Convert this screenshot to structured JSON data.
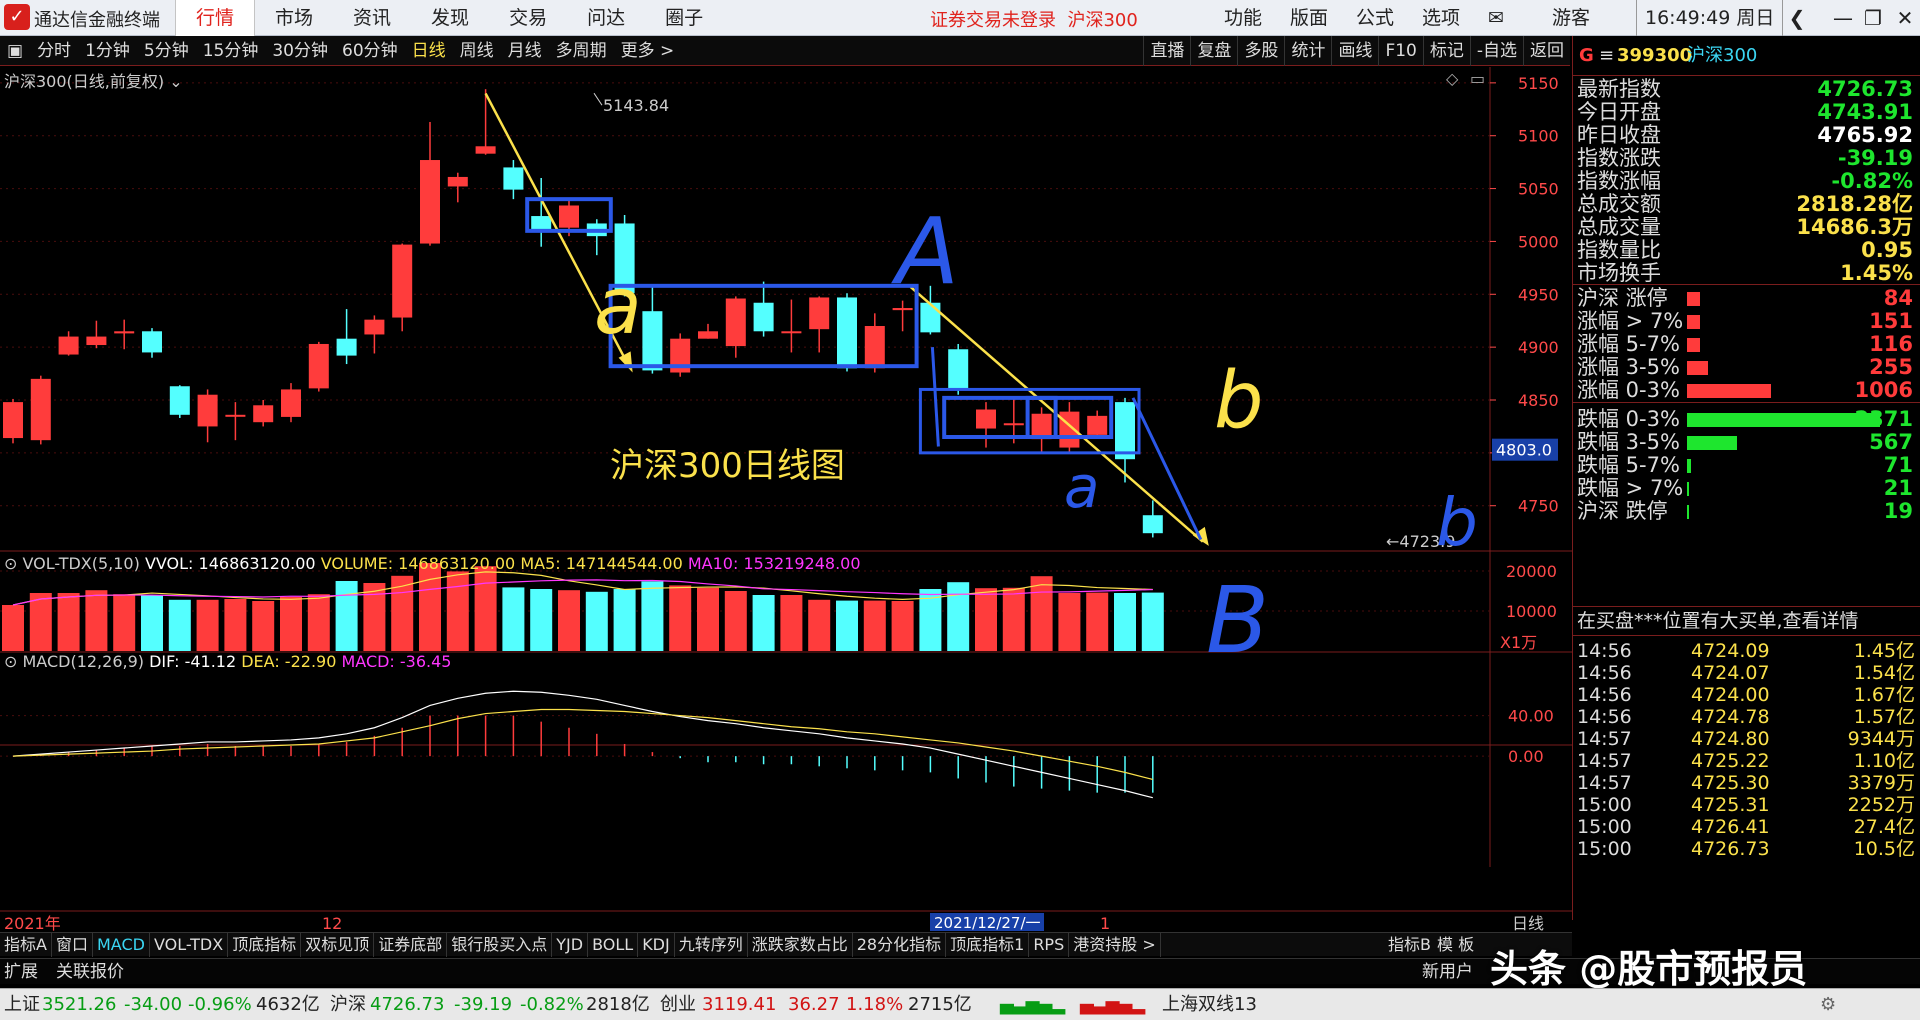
{
  "titlebar": {
    "app_title": "通达信金融终端",
    "menus": [
      "行情",
      "市场",
      "资讯",
      "发现",
      "交易",
      "问达",
      "圈子"
    ],
    "notice": "证券交易未登录",
    "notice_index": "沪深300",
    "right_menus": [
      "功能",
      "版面",
      "公式",
      "选项"
    ],
    "user": "游客",
    "clock": "16:49:49 周日"
  },
  "toolbar": {
    "periods": [
      "分时",
      "1分钟",
      "5分钟",
      "15分钟",
      "30分钟",
      "60分钟",
      "日线",
      "周线",
      "月线",
      "多周期",
      "更多 >"
    ],
    "selected_period": "日线",
    "right_tools": [
      "直播",
      "复盘",
      "多股",
      "统计",
      "画线",
      "F10",
      "标记",
      "-自选",
      "返回"
    ]
  },
  "chart": {
    "label": "沪深300(日线,前复权)",
    "high_label": "5143.84",
    "low_label": "4723.9",
    "price_axis": [
      "5150",
      "5100",
      "5050",
      "5000",
      "4950",
      "4900",
      "4850",
      "4800",
      "4750"
    ],
    "current_price_tag": "4803.0",
    "annotation": "沪深300日线图",
    "hand_labels": {
      "a1": "a",
      "A": "A",
      "b1": "b",
      "a2": "a",
      "b2": "b",
      "B": "B"
    },
    "vol_header": {
      "name": "VOL-TDX(5,10)",
      "vvol": "VVOL: 146863120.00",
      "volume": "VOLUME: 146863120.00",
      "ma5": "MA5: 147144544.00",
      "ma10": "MA10: 153219248.00"
    },
    "vol_axis": [
      "20000",
      "10000"
    ],
    "vol_unit": "X1万",
    "macd_header": {
      "name": "MACD(12,26,9)",
      "dif": "DIF: -41.12",
      "dea": "DEA: -22.90",
      "macd": "MACD: -36.45"
    },
    "macd_axis": [
      "40.00",
      "0.00"
    ],
    "date_axis": {
      "left": "2021年",
      "mid": "12",
      "cursor": "2021/12/27/一",
      "right": "1",
      "period": "日线"
    }
  },
  "chart_data": {
    "type": "candlestick",
    "title": "沪深300(日线,前复权)",
    "candles": [
      {
        "o": 4814,
        "c": 4848,
        "h": 4851,
        "l": 4809
      },
      {
        "o": 4812,
        "c": 4870,
        "h": 4873,
        "l": 4808
      },
      {
        "o": 4893,
        "c": 4910,
        "h": 4915,
        "l": 4892
      },
      {
        "o": 4902,
        "c": 4910,
        "h": 4925,
        "l": 4899
      },
      {
        "o": 4913,
        "c": 4915,
        "h": 4926,
        "l": 4898
      },
      {
        "o": 4915,
        "c": 4895,
        "h": 4918,
        "l": 4890
      },
      {
        "o": 4863,
        "c": 4836,
        "h": 4864,
        "l": 4833
      },
      {
        "o": 4825,
        "c": 4855,
        "h": 4860,
        "l": 4810
      },
      {
        "o": 4835,
        "c": 4836,
        "h": 4848,
        "l": 4812
      },
      {
        "o": 4829,
        "c": 4845,
        "h": 4850,
        "l": 4825
      },
      {
        "o": 4834,
        "c": 4860,
        "h": 4866,
        "l": 4829
      },
      {
        "o": 4861,
        "c": 4903,
        "h": 4905,
        "l": 4858
      },
      {
        "o": 4908,
        "c": 4892,
        "h": 4936,
        "l": 4884
      },
      {
        "o": 4912,
        "c": 4926,
        "h": 4930,
        "l": 4894
      },
      {
        "o": 4928,
        "c": 4997,
        "h": 4998,
        "l": 4915
      },
      {
        "o": 4998,
        "c": 5077,
        "h": 5113,
        "l": 4996
      },
      {
        "o": 5052,
        "c": 5061,
        "h": 5065,
        "l": 5037
      },
      {
        "o": 5083,
        "c": 5090,
        "h": 5144,
        "l": 5082
      },
      {
        "o": 5070,
        "c": 5049,
        "h": 5077,
        "l": 5040
      },
      {
        "o": 5024,
        "c": 5011,
        "h": 5060,
        "l": 4995
      },
      {
        "o": 5013,
        "c": 5034,
        "h": 5040,
        "l": 5005
      },
      {
        "o": 5017,
        "c": 5005,
        "h": 5021,
        "l": 4987
      },
      {
        "o": 5017,
        "c": 4951,
        "h": 5025,
        "l": 4948
      },
      {
        "o": 4934,
        "c": 4878,
        "h": 4958,
        "l": 4875
      },
      {
        "o": 4876,
        "c": 4908,
        "h": 4913,
        "l": 4872
      },
      {
        "o": 4908,
        "c": 4915,
        "h": 4922,
        "l": 4908
      },
      {
        "o": 4901,
        "c": 4946,
        "h": 4948,
        "l": 4890
      },
      {
        "o": 4942,
        "c": 4915,
        "h": 4962,
        "l": 4910
      },
      {
        "o": 4915,
        "c": 4915,
        "h": 4945,
        "l": 4895
      },
      {
        "o": 4917,
        "c": 4947,
        "h": 4948,
        "l": 4895
      },
      {
        "o": 4947,
        "c": 4880,
        "h": 4951,
        "l": 4877
      },
      {
        "o": 4880,
        "c": 4920,
        "h": 4932,
        "l": 4876
      },
      {
        "o": 4935,
        "c": 4937,
        "h": 4944,
        "l": 4915
      },
      {
        "o": 4942,
        "c": 4914,
        "h": 4958,
        "l": 4912
      },
      {
        "o": 4898,
        "c": 4860,
        "h": 4903,
        "l": 4855
      },
      {
        "o": 4823,
        "c": 4841,
        "h": 4848,
        "l": 4805
      },
      {
        "o": 4828,
        "c": 4828,
        "h": 4852,
        "l": 4809
      },
      {
        "o": 4813,
        "c": 4837,
        "h": 4843,
        "l": 4800
      },
      {
        "o": 4805,
        "c": 4839,
        "h": 4848,
        "l": 4799
      },
      {
        "o": 4817,
        "c": 4835,
        "h": 4840,
        "l": 4815
      },
      {
        "o": 4848,
        "c": 4794,
        "h": 4852,
        "l": 4772
      },
      {
        "o": 4741,
        "c": 4724,
        "h": 4755,
        "l": 4720
      }
    ],
    "volume_wan": [
      11500,
      14500,
      14500,
      15200,
      14200,
      14000,
      12800,
      12800,
      13000,
      12500,
      13500,
      14200,
      17500,
      17000,
      18800,
      22000,
      19900,
      21200,
      15900,
      15500,
      15200,
      14800,
      15500,
      17400,
      16400,
      15800,
      15000,
      14000,
      14000,
      12800,
      12600,
      12600,
      12500,
      15500,
      17200,
      15700,
      15800,
      18700,
      14500,
      14600,
      14500,
      14600
    ],
    "macd_dif": [
      0,
      2,
      4,
      6,
      8,
      10,
      12,
      14,
      14,
      15,
      16,
      18,
      22,
      28,
      38,
      50,
      57,
      62,
      64,
      63,
      60,
      56,
      50,
      44,
      39,
      35,
      32,
      28,
      25,
      22,
      18,
      15,
      12,
      8,
      2,
      -4,
      -10,
      -16,
      -22,
      -28,
      -34,
      -41
    ],
    "macd_dea": [
      0,
      1,
      2,
      3,
      4,
      5,
      7,
      8,
      9,
      10,
      11,
      12,
      15,
      18,
      24,
      30,
      37,
      42,
      44,
      46,
      46,
      45,
      44,
      42,
      40,
      38,
      35,
      32,
      29,
      27,
      24,
      22,
      19,
      16,
      13,
      9,
      5,
      0,
      -5,
      -10,
      -16,
      -23
    ],
    "price_range": [
      4710,
      5165
    ],
    "volume_range": [
      0,
      22000
    ],
    "macd_range": [
      -60,
      80
    ]
  },
  "quote": {
    "badge": "G",
    "code": "399300",
    "name": "沪深300",
    "stats": [
      {
        "label": "最新指数",
        "value": "4726.73",
        "color": "#1ee62e"
      },
      {
        "label": "今日开盘",
        "value": "4743.91",
        "color": "#1ee62e"
      },
      {
        "label": "昨日收盘",
        "value": "4765.92",
        "color": "#ffffff"
      },
      {
        "label": "指数涨跌",
        "value": "-39.19",
        "color": "#1ee62e"
      },
      {
        "label": "指数涨幅",
        "value": "-0.82%",
        "color": "#1ee62e"
      },
      {
        "label": "总成交额",
        "value": "2818.28亿",
        "color": "#fbe14b"
      },
      {
        "label": "总成交量",
        "value": "14686.3万",
        "color": "#fbe14b"
      },
      {
        "label": "指数量比",
        "value": "0.95",
        "color": "#fbe14b"
      },
      {
        "label": "市场换手",
        "value": "1.45%",
        "color": "#fbe14b"
      }
    ],
    "breadth_up": [
      {
        "label": "沪深 涨停",
        "value": "84",
        "bar": 0.03
      },
      {
        "label": "涨幅 > 7%",
        "value": "151",
        "bar": 0.03
      },
      {
        "label": "涨幅 5-7%",
        "value": "116",
        "bar": 0.03
      },
      {
        "label": "涨幅 3-5%",
        "value": "255",
        "bar": 0.05
      },
      {
        "label": "涨幅 0-3%",
        "value": "1006",
        "bar": 0.2
      }
    ],
    "breadth_down": [
      {
        "label": "跌幅 0-3%",
        "value": "2371",
        "bar": 0.46
      },
      {
        "label": "跌幅 3-5%",
        "value": "567",
        "bar": 0.12
      },
      {
        "label": "跌幅 5-7%",
        "value": "71",
        "bar": 0.01
      },
      {
        "label": "跌幅 > 7%",
        "value": "21",
        "bar": 0.005
      },
      {
        "label": "沪深 跌停",
        "value": "19",
        "bar": 0.005
      }
    ],
    "news_ticker": "在买盘***位置有大买单,查看详情",
    "ticks": [
      {
        "t": "14:56",
        "p": "4724.09",
        "a": "1.45亿"
      },
      {
        "t": "14:56",
        "p": "4724.07",
        "a": "1.54亿"
      },
      {
        "t": "14:56",
        "p": "4724.00",
        "a": "1.67亿"
      },
      {
        "t": "14:56",
        "p": "4724.78",
        "a": "1.57亿"
      },
      {
        "t": "14:57",
        "p": "4724.80",
        "a": "9344万"
      },
      {
        "t": "14:57",
        "p": "4725.22",
        "a": "1.10亿"
      },
      {
        "t": "14:57",
        "p": "4725.30",
        "a": "3379万"
      },
      {
        "t": "15:00",
        "p": "4725.31",
        "a": "2252万"
      },
      {
        "t": "15:00",
        "p": "4726.41",
        "a": "27.4亿"
      },
      {
        "t": "15:00",
        "p": "4726.73",
        "a": "10.5亿"
      }
    ]
  },
  "indicator_tabs": [
    "指标A",
    "窗口",
    "MACD",
    "VOL-TDX",
    "顶底指标",
    "双标见顶",
    "证券底部",
    "银行股买入点",
    "YJD",
    "BOLL",
    "KDJ",
    "九转序列",
    "涨跌家数占比",
    "28分化指标",
    "顶底指标1",
    "RPS",
    "港资持股 >"
  ],
  "selected_tab": "MACD",
  "indicator_right": [
    "指标B",
    "模 板"
  ],
  "ext_bar": {
    "left1": "扩展",
    "left2": "关联报价",
    "right": "新用户"
  },
  "watermark": "头条 @股市预报员",
  "statusbar": {
    "sh_label": "上证",
    "sh_val": "3521.26",
    "sh_chg": "-34.00",
    "sh_pct": "-0.96%",
    "sh_amt": "4632亿",
    "hs_label": "沪深",
    "hs_val": "4726.73",
    "hs_chg": "-39.19",
    "hs_pct": "-0.82%",
    "hs_amt": "2818亿",
    "cy_label": "创业",
    "cy_val": "3119.41",
    "cy_chg": "36.27",
    "cy_pct": "1.18%",
    "cy_amt": "2715亿",
    "line": "上海双线13"
  }
}
